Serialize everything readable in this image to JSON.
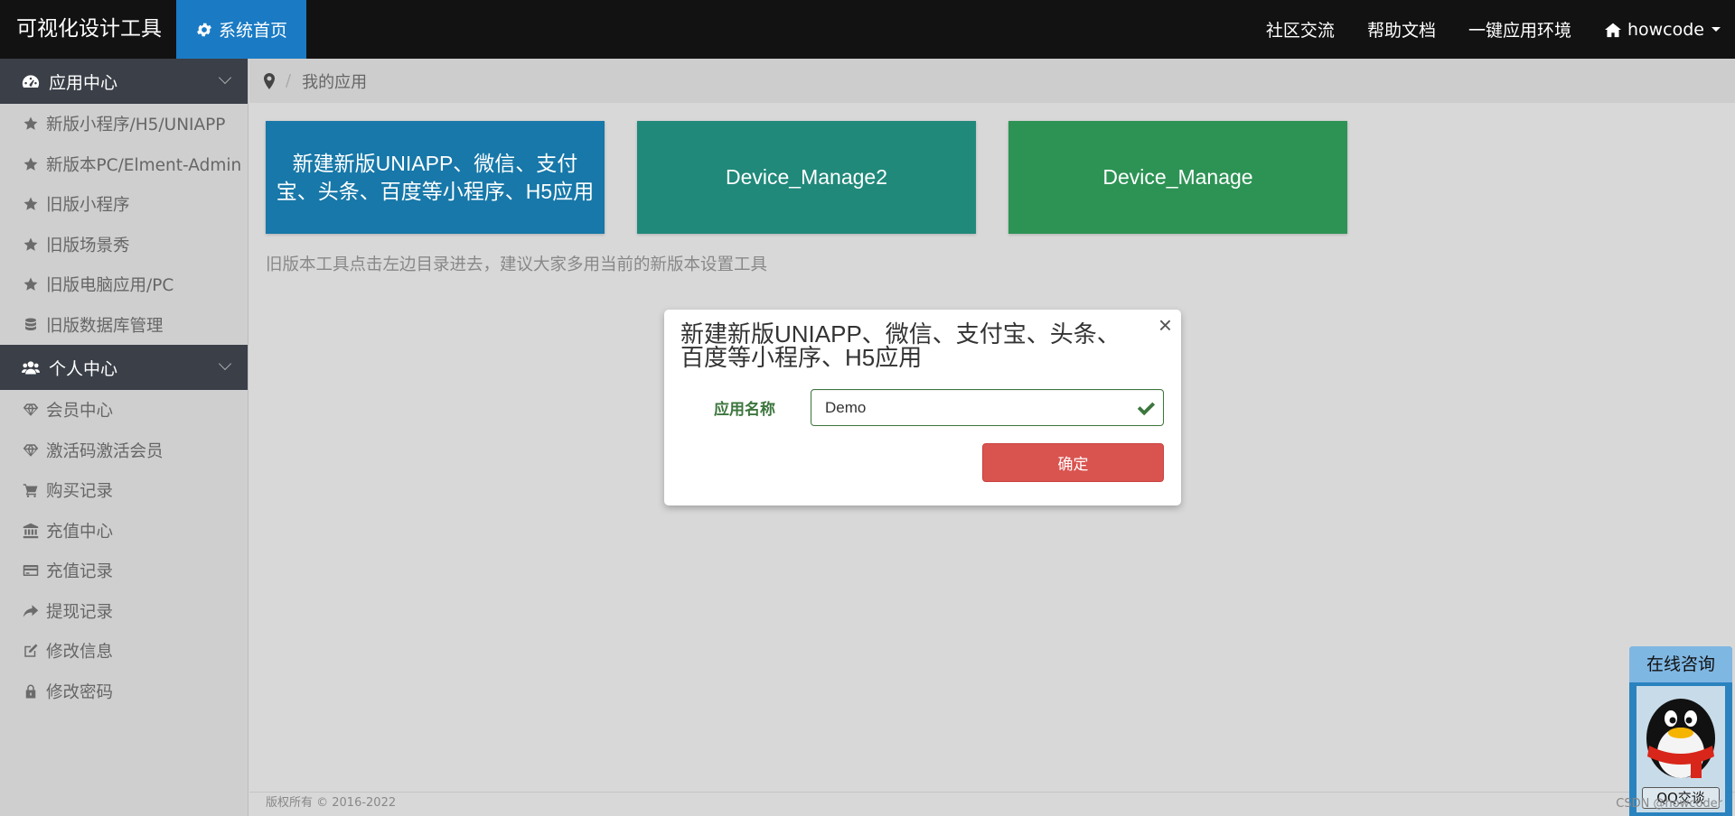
{
  "header": {
    "brand": "可视化设计工具",
    "home_tab": "系统首页",
    "nav": [
      "社区交流",
      "帮助文档",
      "一键应用环境"
    ],
    "user": "howcode"
  },
  "sidebar": {
    "sections": [
      {
        "title": "应用中心",
        "icon": "dashboard-icon",
        "items": [
          {
            "label": "新版小程序/H5/UNIAPP",
            "icon": "star-icon"
          },
          {
            "label": "新版本PC/Elment-Admin",
            "icon": "star-icon"
          },
          {
            "label": "旧版小程序",
            "icon": "star-icon"
          },
          {
            "label": "旧版场景秀",
            "icon": "star-icon"
          },
          {
            "label": "旧版电脑应用/PC",
            "icon": "star-icon"
          },
          {
            "label": "旧版数据库管理",
            "icon": "database-icon"
          }
        ]
      },
      {
        "title": "个人中心",
        "icon": "users-icon",
        "items": [
          {
            "label": "会员中心",
            "icon": "diamond-icon"
          },
          {
            "label": "激活码激活会员",
            "icon": "diamond-icon"
          },
          {
            "label": "购买记录",
            "icon": "cart-icon"
          },
          {
            "label": "充值中心",
            "icon": "bank-icon"
          },
          {
            "label": "充值记录",
            "icon": "credit-card-icon"
          },
          {
            "label": "提现记录",
            "icon": "share-icon"
          },
          {
            "label": "修改信息",
            "icon": "edit-icon"
          },
          {
            "label": "修改密码",
            "icon": "lock-icon"
          }
        ]
      }
    ]
  },
  "breadcrumb": {
    "current": "我的应用"
  },
  "cards": [
    {
      "label": "新建新版UNIAPP、微信、支付宝、头条、百度等小程序、H5应用",
      "color": "#1778a9"
    },
    {
      "label": "Device_Manage2",
      "color": "#20897a"
    },
    {
      "label": "Device_Manage",
      "color": "#2d9355"
    }
  ],
  "note": "旧版本工具点击左边目录进去，建议大家多用当前的新版本设置工具",
  "modal": {
    "title": "新建新版UNIAPP、微信、支付宝、头条、百度等小程序、H5应用",
    "close": "×",
    "field_label": "应用名称",
    "field_value": "Demo",
    "confirm_label": "确定"
  },
  "footer": {
    "copyright": "版权所有 © 2016-2022",
    "watermark": "CSDN @howcoder"
  },
  "qq_widget": {
    "title": "在线咨询",
    "label": "QQ交谈"
  }
}
